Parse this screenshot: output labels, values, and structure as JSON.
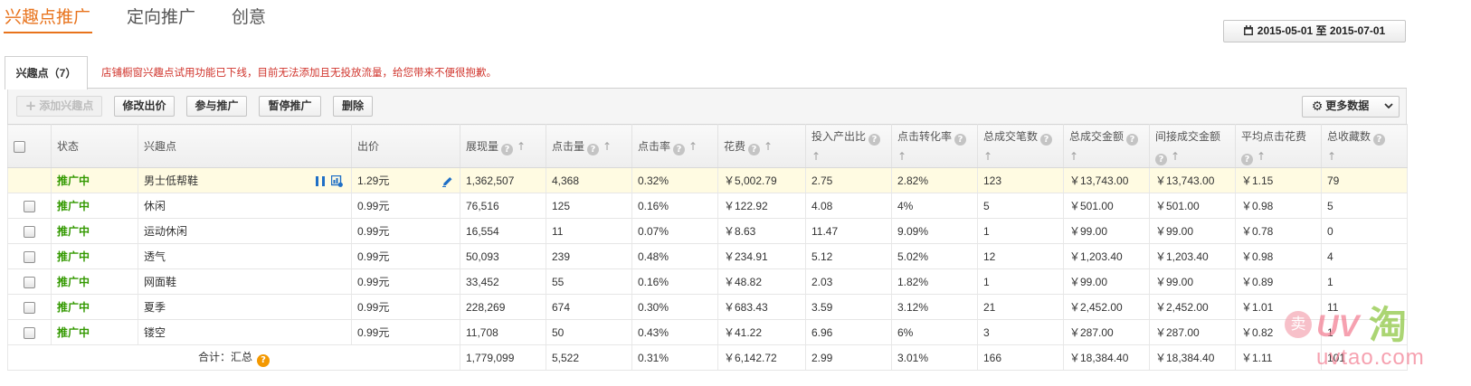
{
  "top_tabs": [
    {
      "label": "兴趣点推广",
      "active": true
    },
    {
      "label": "定向推广",
      "active": false
    },
    {
      "label": "创意",
      "active": false
    }
  ],
  "date_range": {
    "label": "2015-05-01 至 2015-07-01",
    "icon": "calendar-icon"
  },
  "sub_tab": {
    "label": "兴趣点（7）",
    "active": true
  },
  "notice": "店铺橱窗兴趣点试用功能已下线，目前无法添加且无投放流量，给您带来不便很抱歉。",
  "toolbar": {
    "add_label": "添加兴趣点",
    "add_disabled": true,
    "add_icon": "plus-icon",
    "edit_bid_label": "修改出价",
    "join_label": "参与推广",
    "pause_label": "暂停推广",
    "delete_label": "删除",
    "more_data_label": "更多数据",
    "more_data_icon": "gear-icon",
    "dropdown_icon": "chevron-down-icon"
  },
  "table": {
    "select_all_checked": false,
    "row_action_icons": [
      "pause-icon",
      "chart-icon"
    ],
    "bid_edit_icon": "edit-icon",
    "columns": [
      {
        "key": "status",
        "label": "状态"
      },
      {
        "key": "name",
        "label": "兴趣点"
      },
      {
        "key": "bid",
        "label": "出价"
      },
      {
        "key": "impressions",
        "label": "展现量",
        "help": true,
        "sortable": true
      },
      {
        "key": "clicks",
        "label": "点击量",
        "help": true,
        "sortable": true
      },
      {
        "key": "ctr",
        "label": "点击率",
        "help": true,
        "sortable": true
      },
      {
        "key": "cost",
        "label": "花费",
        "help": true,
        "sortable": true
      },
      {
        "key": "roi",
        "label": "投入产出比",
        "help": true,
        "sortable": true
      },
      {
        "key": "cvr",
        "label": "点击转化率",
        "help": true,
        "sortable": true
      },
      {
        "key": "orders",
        "label": "总成交笔数",
        "help": true,
        "sortable": true
      },
      {
        "key": "gmv",
        "label": "总成交金额",
        "help": true,
        "sortable": true
      },
      {
        "key": "indirect_gmv",
        "label": "间接成交金额",
        "help": true,
        "sortable": true
      },
      {
        "key": "cpc",
        "label": "平均点击花费",
        "help": true,
        "sortable": true
      },
      {
        "key": "favorites",
        "label": "总收藏数",
        "help": true,
        "sortable": true
      }
    ],
    "rows": [
      {
        "highlighted": true,
        "status": "推广中",
        "name": "男士低帮鞋",
        "bid": "1.29元",
        "impressions": "1,362,507",
        "clicks": "4,368",
        "ctr": "0.32%",
        "cost": "￥5,002.79",
        "roi": "2.75",
        "cvr": "2.82%",
        "orders": "123",
        "gmv": "￥13,743.00",
        "indirect_gmv": "￥13,743.00",
        "cpc": "￥1.15",
        "favorites": "79"
      },
      {
        "highlighted": false,
        "status": "推广中",
        "name": "休闲",
        "bid": "0.99元",
        "impressions": "76,516",
        "clicks": "125",
        "ctr": "0.16%",
        "cost": "￥122.92",
        "roi": "4.08",
        "cvr": "4%",
        "orders": "5",
        "gmv": "￥501.00",
        "indirect_gmv": "￥501.00",
        "cpc": "￥0.98",
        "favorites": "5"
      },
      {
        "highlighted": false,
        "status": "推广中",
        "name": "运动休闲",
        "bid": "0.99元",
        "impressions": "16,554",
        "clicks": "11",
        "ctr": "0.07%",
        "cost": "￥8.63",
        "roi": "11.47",
        "cvr": "9.09%",
        "orders": "1",
        "gmv": "￥99.00",
        "indirect_gmv": "￥99.00",
        "cpc": "￥0.78",
        "favorites": "0"
      },
      {
        "highlighted": false,
        "status": "推广中",
        "name": "透气",
        "bid": "0.99元",
        "impressions": "50,093",
        "clicks": "239",
        "ctr": "0.48%",
        "cost": "￥234.91",
        "roi": "5.12",
        "cvr": "5.02%",
        "orders": "12",
        "gmv": "￥1,203.40",
        "indirect_gmv": "￥1,203.40",
        "cpc": "￥0.98",
        "favorites": "4"
      },
      {
        "highlighted": false,
        "status": "推广中",
        "name": "网面鞋",
        "bid": "0.99元",
        "impressions": "33,452",
        "clicks": "55",
        "ctr": "0.16%",
        "cost": "￥48.82",
        "roi": "2.03",
        "cvr": "1.82%",
        "orders": "1",
        "gmv": "￥99.00",
        "indirect_gmv": "￥99.00",
        "cpc": "￥0.89",
        "favorites": "1"
      },
      {
        "highlighted": false,
        "status": "推广中",
        "name": "夏季",
        "bid": "0.99元",
        "impressions": "228,269",
        "clicks": "674",
        "ctr": "0.30%",
        "cost": "￥683.43",
        "roi": "3.59",
        "cvr": "3.12%",
        "orders": "21",
        "gmv": "￥2,452.00",
        "indirect_gmv": "￥2,452.00",
        "cpc": "￥1.01",
        "favorites": "11"
      },
      {
        "highlighted": false,
        "status": "推广中",
        "name": "镂空",
        "bid": "0.99元",
        "impressions": "11,708",
        "clicks": "50",
        "ctr": "0.43%",
        "cost": "￥41.22",
        "roi": "6.96",
        "cvr": "6%",
        "orders": "3",
        "gmv": "￥287.00",
        "indirect_gmv": "￥287.00",
        "cpc": "￥0.82",
        "favorites": "1"
      }
    ],
    "total": {
      "label": "合计：汇总",
      "impressions": "1,779,099",
      "clicks": "5,522",
      "ctr": "0.31%",
      "cost": "￥6,142.72",
      "roi": "2.99",
      "cvr": "3.01%",
      "orders": "166",
      "gmv": "￥18,384.40",
      "indirect_gmv": "￥18,384.40",
      "cpc": "￥1.11",
      "favorites": "101"
    }
  },
  "watermark": {
    "badge": "卖",
    "logo_uv": "UV",
    "logo_tao": "淘",
    "domain": "uvtao.com"
  },
  "colors": {
    "active_tab": "#e8731c",
    "notice_text": "#d0342c",
    "status_active": "#339900",
    "highlight_row": "#fffbe2",
    "action_icon": "#1f6fc6",
    "total_help_icon": "#f39800"
  }
}
